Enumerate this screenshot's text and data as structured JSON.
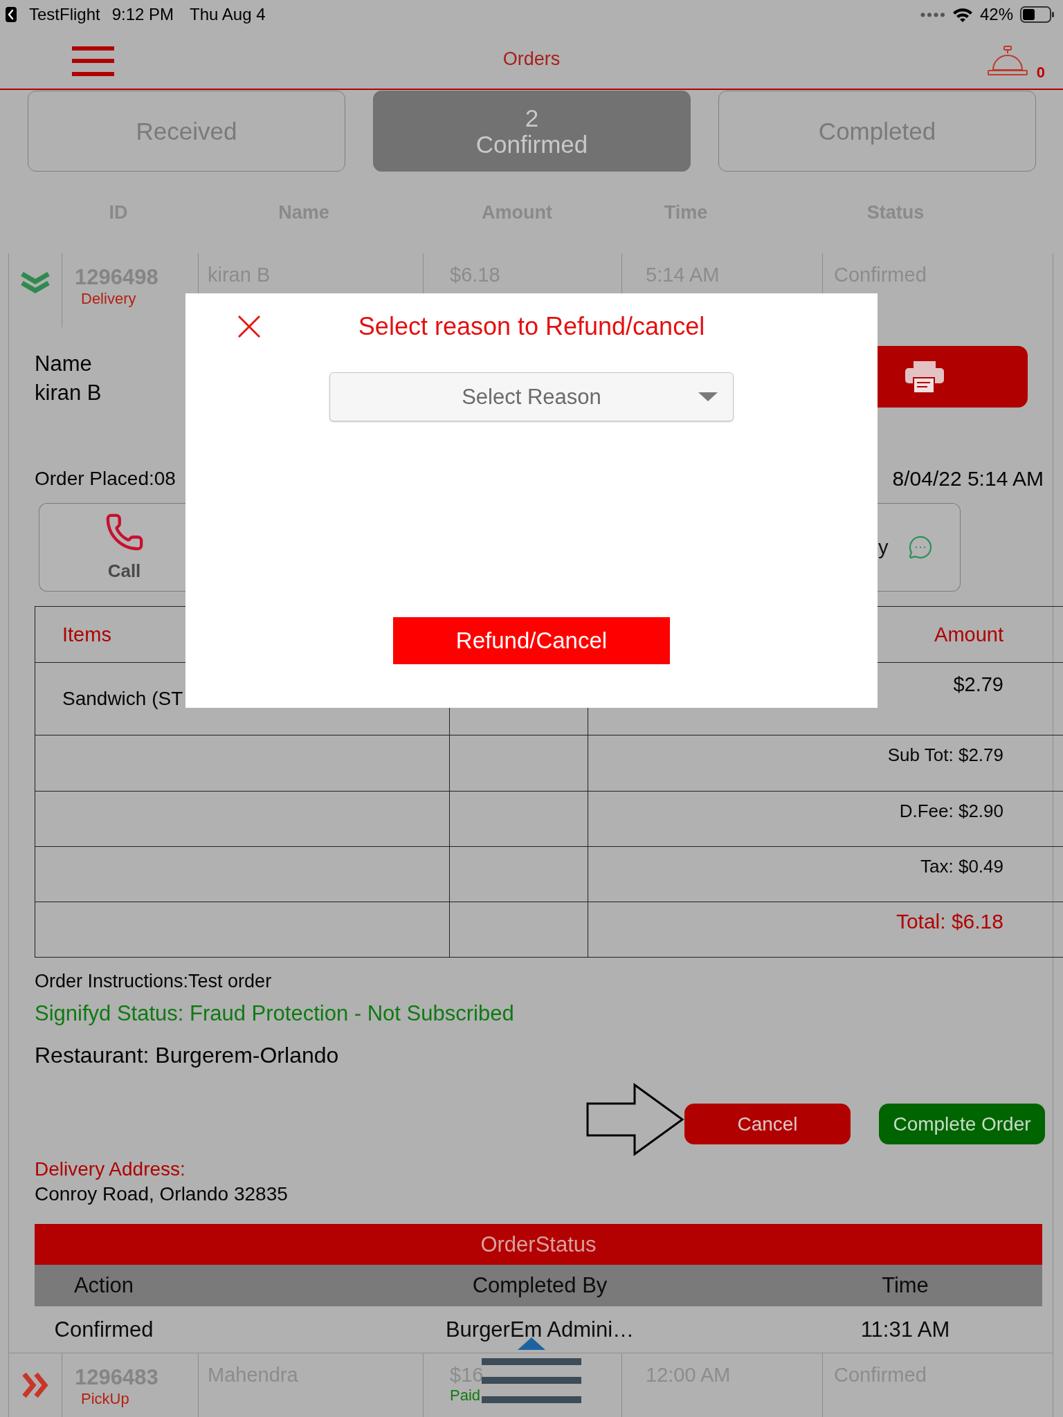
{
  "status_bar": {
    "back_label": "TestFlight",
    "time": "9:12 PM",
    "date": "Thu Aug 4",
    "battery": "42%"
  },
  "nav": {
    "title": "Orders",
    "bell_count": "0"
  },
  "tabs": [
    {
      "label": "Received",
      "selected": false
    },
    {
      "count": "2",
      "label": "Confirmed",
      "selected": true
    },
    {
      "label": "Completed",
      "selected": false
    }
  ],
  "columns": [
    "ID",
    "Name",
    "Amount",
    "Time",
    "Status"
  ],
  "orders": [
    {
      "id": "1296498",
      "type": "Delivery",
      "name": "kiran B",
      "amount": "$6.18",
      "time": "5:14 AM",
      "status": "Confirmed",
      "expanded": true,
      "details": {
        "name_label": "Name",
        "customer_name": "kiran B",
        "order_placed": "Order Placed:08",
        "placed_time": "8/04/22 5:14 AM",
        "call_label": "Call",
        "message_label": "y",
        "items": {
          "columns": [
            "Items",
            "Amount"
          ],
          "rows": [
            {
              "item": "Sandwich (ST",
              "amount": "$2.79"
            }
          ],
          "summary": [
            {
              "kind": "line",
              "text": "Sub Tot: $2.79"
            },
            {
              "kind": "line",
              "text": "D.Fee: $2.90"
            },
            {
              "kind": "line",
              "text": "Tax: $0.49"
            },
            {
              "kind": "total",
              "text": "Total: $6.18"
            }
          ]
        },
        "instructions": "Order Instructions:Test order",
        "signifyd_status": "Signifyd Status: Fraud Protection - Not Subscribed",
        "restaurant": "Restaurant: Burgerem-Orlando",
        "actions": [
          {
            "kind": "cancel",
            "label": "Cancel"
          },
          {
            "kind": "complete",
            "label": "Complete Order"
          }
        ],
        "address_label": "Delivery Address:",
        "address": "Conroy Road, Orlando 32835",
        "order_status": {
          "title": "OrderStatus",
          "columns": [
            "Action",
            "Completed By",
            "Time"
          ],
          "rows": [
            [
              "Confirmed",
              "BurgerEm Admini…",
              "11:31 AM"
            ]
          ]
        }
      }
    },
    {
      "id": "1296483",
      "type": "PickUp",
      "name": "Mahendra",
      "amount": "$16",
      "payment": "Paid",
      "time": "12:00 AM",
      "status": "Confirmed",
      "expanded": false
    }
  ],
  "modal": {
    "title": "Select reason to Refund/cancel",
    "reason_select": {
      "placeholder": "Select Reason"
    },
    "button": "Refund/Cancel"
  }
}
